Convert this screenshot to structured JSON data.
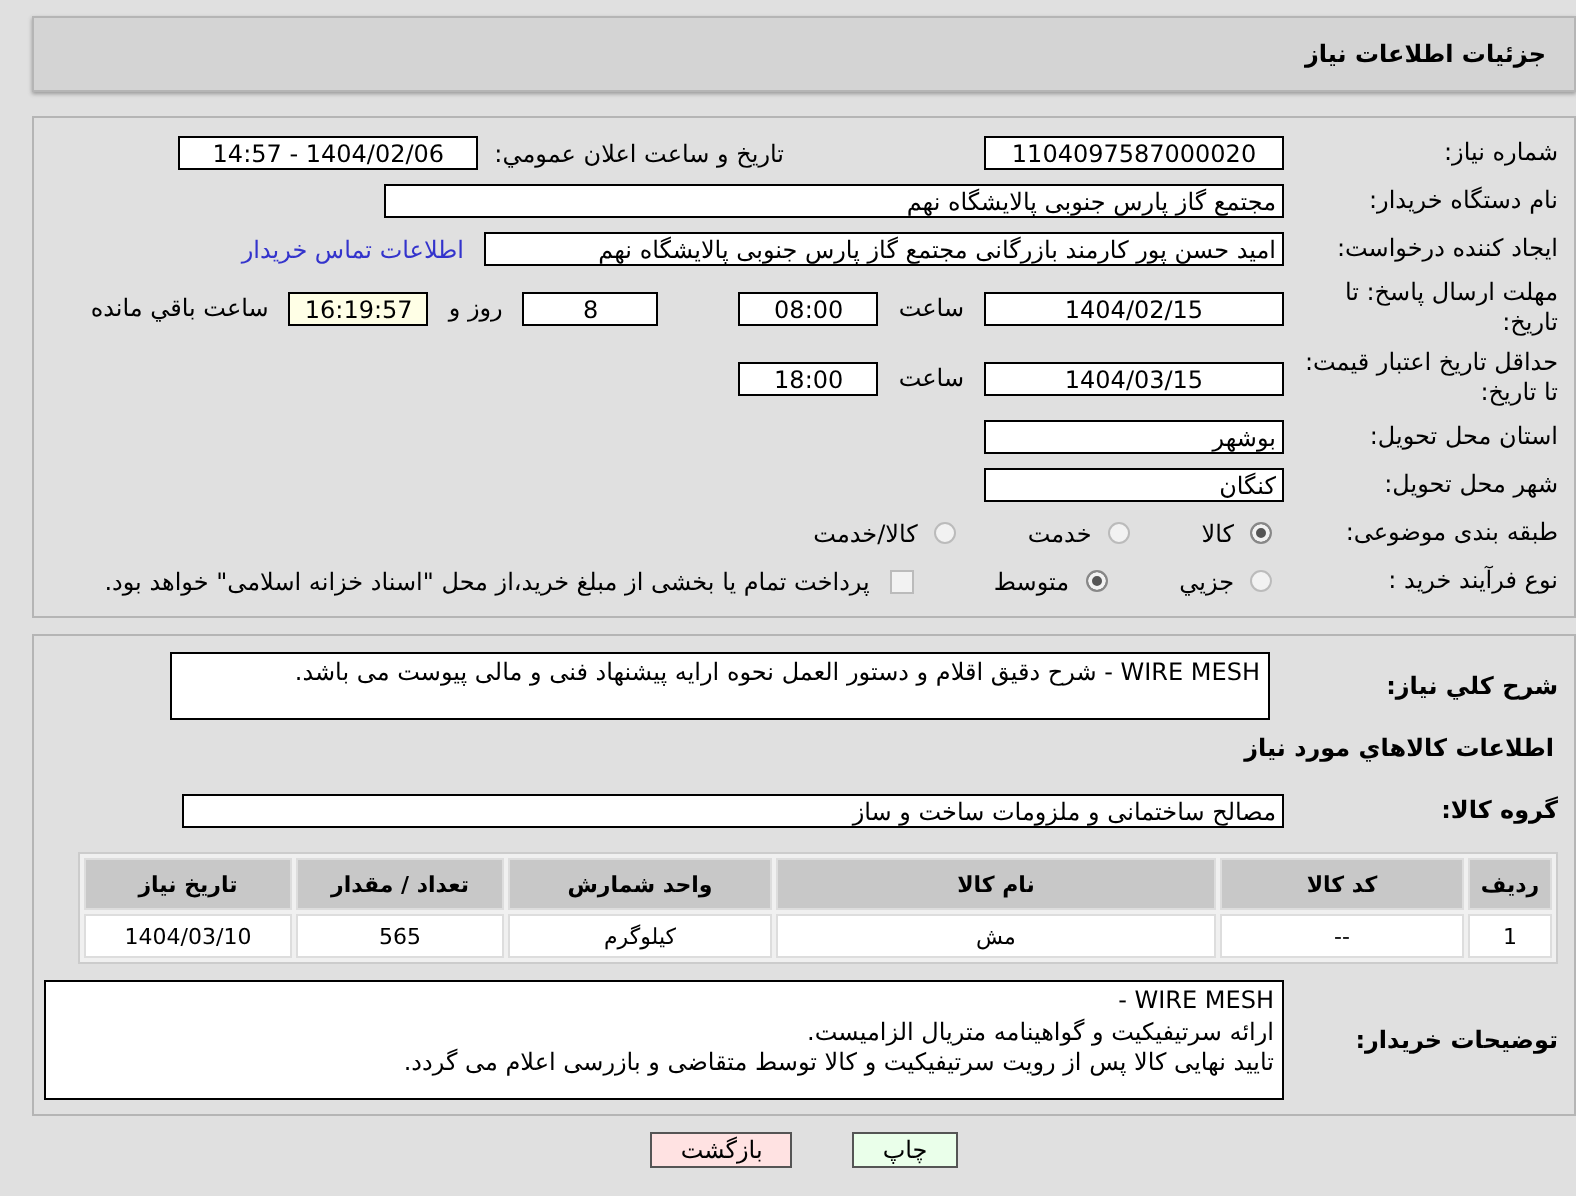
{
  "header": {
    "title": "جزئیات اطلاعات نیاز"
  },
  "need_number": {
    "label": "شماره نیاز:",
    "value": "1104097587000020"
  },
  "announce": {
    "label": "تاریخ و ساعت اعلان عمومي:",
    "value": "1404/02/06 - 14:57"
  },
  "buyer_org": {
    "label": "نام دستگاه خریدار:",
    "value": "مجتمع گاز پارس جنوبی  پالایشگاه نهم"
  },
  "creator": {
    "label": "ایجاد کننده درخواست:",
    "value": "امید حسن پور کارمند بازرگانی مجتمع گاز پارس جنوبی  پالایشگاه نهم",
    "link": "اطلاعات تماس خریدار"
  },
  "deadline": {
    "label": "مهلت ارسال پاسخ: تا تاریخ:",
    "date": "1404/02/15",
    "time_label": "ساعت",
    "time": "08:00",
    "days": "8",
    "days_label": "روز و",
    "remaining": "16:19:57",
    "remaining_label": "ساعت باقي مانده"
  },
  "validity": {
    "label": "حداقل تاریخ اعتبار قیمت: تا تاریخ:",
    "date": "1404/03/15",
    "time_label": "ساعت",
    "time": "18:00"
  },
  "province": {
    "label": "استان محل تحویل:",
    "value": "بوشهر"
  },
  "city": {
    "label": "شهر محل تحویل:",
    "value": "کنگان"
  },
  "category": {
    "label": "طبقه بندی موضوعی:",
    "options": [
      {
        "label": "كالا",
        "selected": true
      },
      {
        "label": "خدمت",
        "selected": false
      },
      {
        "label": "كالا/خدمت",
        "selected": false
      }
    ]
  },
  "purchase_type": {
    "label": "نوع فرآیند خرید :",
    "options": [
      {
        "label": "جزيي",
        "selected": false
      },
      {
        "label": "متوسط",
        "selected": true
      }
    ],
    "payment_checkbox": {
      "checked": false,
      "label": "پرداخت تمام یا بخشی از مبلغ خرید،از محل \"اسناد خزانه اسلامی\" خواهد بود."
    }
  },
  "description": {
    "label": "شرح کلي نیاز:",
    "value": "WIRE MESH - شرح دقیق اقلام و دستور العمل نحوه ارایه پیشنهاد فنی و مالی پیوست می باشد."
  },
  "goods_title": "اطلاعات كالاهاي مورد نیاز",
  "goods_group": {
    "label": "گروه کالا:",
    "value": "مصالح ساختمانی و ملزومات ساخت و ساز"
  },
  "table": {
    "columns": [
      "ردیف",
      "کد کالا",
      "نام کالا",
      "واحد شمارش",
      "تعداد / مقدار",
      "تاریخ نیاز"
    ],
    "rows": [
      [
        "1",
        "--",
        "مش",
        "کیلوگرم",
        "565",
        "1404/03/10"
      ]
    ]
  },
  "buyer_notes": {
    "label": "توضیحات خریدار:",
    "lines": [
      "WIRE MESH -",
      "ارائه سرتیفیکیت و گواهینامه متریال الزامیست.",
      "تایید نهایی کالا پس از رویت سرتیفیکیت و کالا توسط متقاضی و بازرسی اعلام می گردد."
    ]
  },
  "buttons": [
    {
      "label": "چاپ",
      "kind": "print"
    },
    {
      "label": "بازگشت",
      "kind": "back"
    }
  ]
}
